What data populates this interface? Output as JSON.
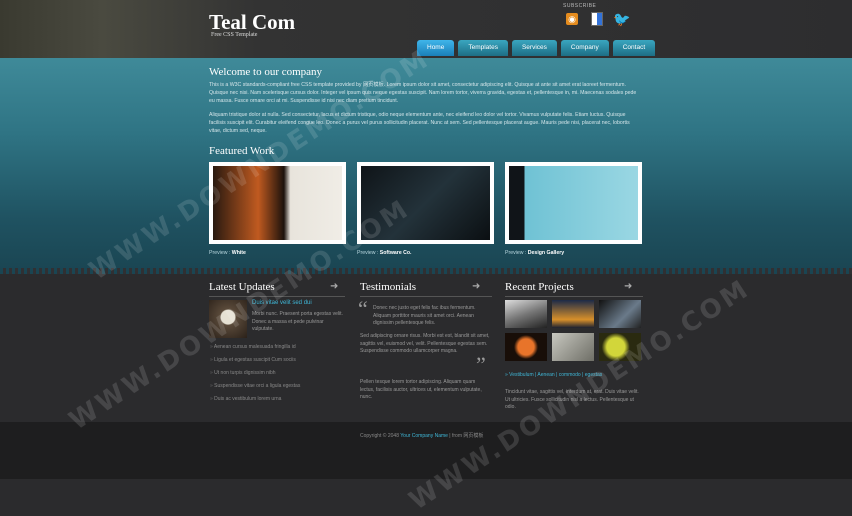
{
  "header": {
    "logo": "Teal Com",
    "tagline": "Free CSS Template",
    "subscribe_label": "SUBSCRIBE",
    "social": [
      {
        "icon": "rss-icon"
      },
      {
        "icon": "delicious-icon"
      },
      {
        "icon": "twitter-icon"
      }
    ]
  },
  "nav": {
    "items": [
      "Home",
      "Templates",
      "Services",
      "Company",
      "Contact"
    ],
    "active": "Home"
  },
  "hero": {
    "welcome_title": "Welcome to our company",
    "para1": "This is a W3C standards-compliant free CSS template provided by 网页模板. Lorem ipsum dolor sit amet, consectetur adipiscing elit. Quisque at ante sit amet erat laoreet fermentum. Quisque nec nisi. Nam scelerisque cursus dolor. Integer vel ipsum quis neque egestas suscipit. Nam lorem tortor, viverra gravida, egestas et, pellentesque in, mi. Maecenas sodales pede eu massa. Fusce ornare orci at mi. Suspendisse id nisi nec diam pretium tincidunt.",
    "para2": "Aliquam tristique dolor at nulla. Sed consectetur, lacus et dictum tristique, odio neque elementum ante, nec eleifend leo dolor vel tortor. Vivamus vulputate felis. Etiam luctus. Quisque facilisis suscipit elit. Curabitur eleifend congue leo. Donec a purus vel purus sollicitudin placerat. Nunc at sem. Sed pellentesque placerat augue. Mauris pede nisi, placerat nec, lobortis vitae, dictum sed, neque.",
    "featured_title": "Featured Work",
    "works": [
      {
        "preview": "Preview :",
        "name": "White"
      },
      {
        "preview": "Preview :",
        "name": "Software Co."
      },
      {
        "preview": "Preview :",
        "name": "Design Gallery"
      }
    ]
  },
  "updates": {
    "title": "Latest Updates",
    "post_title": "Duis vitae velit sed dui",
    "post_text": "Morbi nunc. Praesent porta egestas velit. Donec a massa et pede pulvinar vulputate.",
    "items": [
      "Aenean cursus malesuada fringilla id",
      "Ligula et egestas suscipit Cum sociis",
      "Ut non turpis dignissim nibh",
      "Suspendisse vitae orci a ligula egestas",
      "Duis ac vestibulum lorem urna"
    ]
  },
  "testimonials": {
    "title": "Testimonials",
    "p1": "Donec nec justo eget felis fac ibus fermentum. Aliquam porttitor mauris sit amet orci. Aenean dignissim pellentesque felis.",
    "p2": "Sed adipiscing ornare risus. Morbi est est, blandit sit amet, sagittis vel, euismod vel, velit. Pellentesque egestas sem. Suspendisse commodo ullamcorper magna.",
    "p3": "Pellen tesque lorem tortor adipiscing. Aliquam quam lectus, facilisis auctor, ultrices ut, elementum vulputate, nunc."
  },
  "projects": {
    "title": "Recent Projects",
    "links": "» Vestibulum | Aenean | commodo | egestas",
    "text": "Tincidunt vitae, sagittis vel, interdum at, erat. Duis vitae velit. Ut ultricies. Fusce sollicitudin nisl a lectus. Pellentesque ut odio."
  },
  "footer": {
    "copyright": "Copyright © 2048",
    "company": "Your Company Name",
    "sep": " | from",
    "credit": "网页模板"
  },
  "watermark": "WWW.DOWNDEMO.COM",
  "colors": {
    "accent": "#3fb6d6",
    "hero": "#2f7484",
    "nav": "#1d6e85"
  }
}
